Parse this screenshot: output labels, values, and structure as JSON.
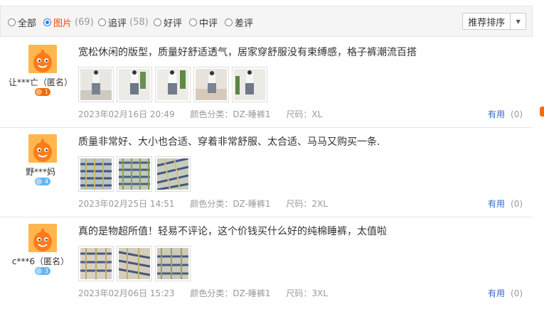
{
  "filters": [
    {
      "label": "全部",
      "count": "",
      "selected": false
    },
    {
      "label": "图片",
      "count": "(69)",
      "selected": true
    },
    {
      "label": "追评",
      "count": "(58)",
      "selected": false
    },
    {
      "label": "好评",
      "count": "",
      "selected": false
    },
    {
      "label": "中评",
      "count": "",
      "selected": false
    },
    {
      "label": "差评",
      "count": "",
      "selected": false
    }
  ],
  "sort": {
    "label": "推荐排序",
    "arrow": "▼"
  },
  "reviews": [
    {
      "user": "让***亡（匿名）",
      "level": "1",
      "comment": "宽松休闲的版型，质量好舒适透气，居家穿舒服没有束缚感，格子裤潮流百搭",
      "date": "2023年02月16日 20:49",
      "color": "颜色分类：DZ-睡裤1",
      "size": "尺码：XL",
      "useful": "有用",
      "useful_count": "(0)"
    },
    {
      "user": "野***妈",
      "level": "4",
      "comment": "质量非常好、大小也合适、穿着非常舒服、太合适、马马又购买一条.",
      "date": "2023年02月25日 14:51",
      "color": "颜色分类：DZ-睡裤1",
      "size": "尺码：2XL",
      "useful": "有用",
      "useful_count": "(0)"
    },
    {
      "user": "c***6（匿名）",
      "level": "3",
      "comment": "真的是物超所值！轻易不评论，这个价钱买什么好的纯棉睡裤，太值啦",
      "date": "2023年02月06日 15:23",
      "color": "颜色分类：DZ-睡裤1",
      "size": "尺码：3XL",
      "useful": "有用",
      "useful_count": "(0)"
    }
  ]
}
